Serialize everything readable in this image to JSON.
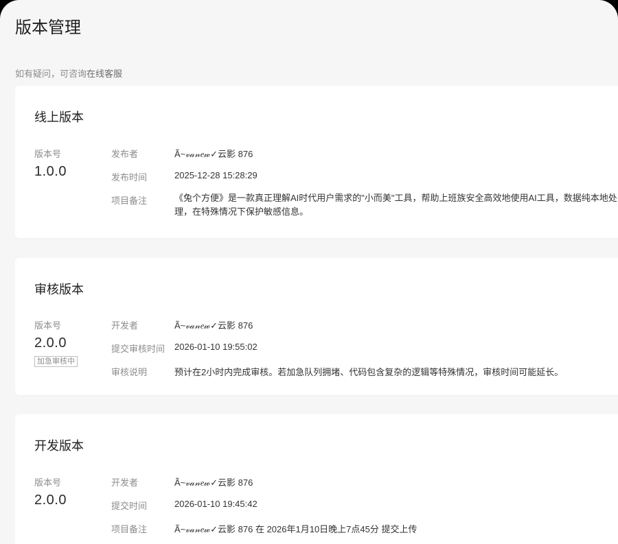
{
  "page": {
    "title": "版本管理",
    "help_prefix": "如有疑问，可咨询",
    "help_link": "在线客服"
  },
  "online": {
    "title": "线上版本",
    "version_label": "版本号",
    "version": "1.0.0",
    "publisher_label": "发布者",
    "publisher": "Ã~𝓋𝒶𝓃𝑒𝓌✓云影 876",
    "time_label": "发布时间",
    "time": "2025-12-28 15:28:29",
    "note_label": "项目备注",
    "note": "《兔个方便》是一款真正理解AI时代用户需求的\"小而美\"工具，帮助上班族安全高效地使用AI工具，数据纯本地处理，在特殊情况下保护敏感信息。"
  },
  "review": {
    "title": "审核版本",
    "version_label": "版本号",
    "version": "2.0.0",
    "badge": "加急审核中",
    "developer_label": "开发者",
    "developer": "Ã~𝓋𝒶𝓃𝑒𝓌✓云影 876",
    "time_label": "提交审核时间",
    "time": "2026-01-10 19:55:02",
    "note_label": "审核说明",
    "note": "预计在2小时内完成审核。若加急队列拥堵、代码包含复杂的逻辑等特殊情况，审核时间可能延长。"
  },
  "dev": {
    "title": "开发版本",
    "version_label": "版本号",
    "version": "2.0.0",
    "developer_label": "开发者",
    "developer": "Ã~𝓋𝒶𝓃𝑒𝓌✓云影 876",
    "time_label": "提交时间",
    "time": "2026-01-10 19:45:42",
    "note_label": "项目备注",
    "note": "Ã~𝓋𝒶𝓃𝑒𝓌✓云影 876 在 2026年1月10日晚上7点45分 提交上传"
  }
}
